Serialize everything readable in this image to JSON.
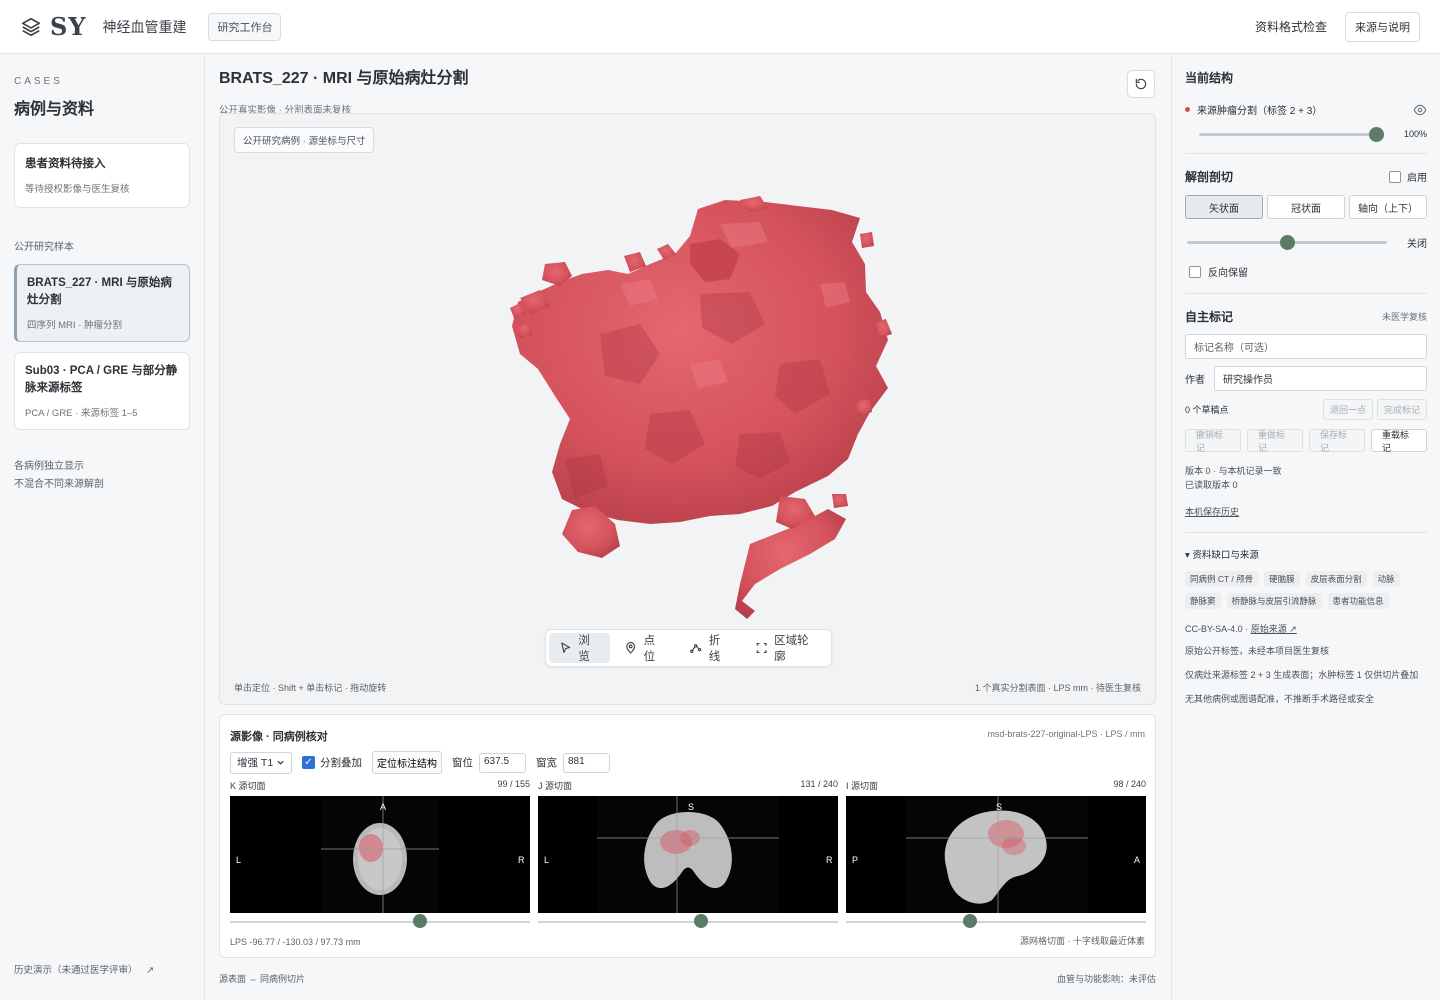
{
  "app": {
    "logo_text": "SY",
    "name": "神经血管重建",
    "workbench": "研究工作台",
    "format_check": "资料格式检查",
    "source_notes": "来源与说明"
  },
  "sidebar": {
    "kicker": "CASES",
    "title": "病例与资料",
    "pending": {
      "title": "患者资料待接入",
      "sub": "等待授权影像与医生复核"
    },
    "section": "公开研究样本",
    "cases": [
      {
        "title": "BRATS_227 · MRI 与原始病灶分割",
        "sub": "四序列 MRI · 肿瘤分割"
      },
      {
        "title": "Sub03 · PCA / GRE 与部分静脉来源标签",
        "sub": "PCA / GRE · 来源标签 1–5"
      }
    ],
    "note_1": "各病例独立显示",
    "note_2": "不混合不同来源解剖",
    "history": "历史演示（未通过医学评审）",
    "history_arrow": "↗"
  },
  "main": {
    "title": "BRATS_227 · MRI 与原始病灶分割",
    "sub": "公开真实影像 · 分割表面未复核",
    "viewer_chip": "公开研究病例 · 源坐标与尺寸",
    "tools": [
      {
        "label": "浏览",
        "icon": "cursor-icon"
      },
      {
        "label": "点位",
        "icon": "pin-icon"
      },
      {
        "label": "折线",
        "icon": "polyline-icon"
      },
      {
        "label": "区域轮廓",
        "icon": "region-icon"
      }
    ],
    "hint_left": "单击定位 · Shift + 单击标记 · 拖动旋转",
    "hint_right": "1 个真实分割表面 · LPS mm · 待医生复核",
    "foot_left": "源表面 ⇔ 同病例切片",
    "foot_right": "血管与功能影响：未评估"
  },
  "source": {
    "title": "源影像 · 同病例核对",
    "dataset_id": "msd-brats-227-original-LPS · LPS / mm",
    "sequence": "增强 T1",
    "overlay_label": "分割叠加",
    "locate_btn": "定位标注结构",
    "window_level_label": "窗位",
    "window_level_value": "637.5",
    "window_width_label": "窗宽",
    "window_width_value": "881",
    "slices": [
      {
        "name": "K 源切面",
        "index": "99 / 155",
        "top": "A",
        "left": "L",
        "right": "R",
        "fraction": 0.64
      },
      {
        "name": "J 源切面",
        "index": "131 / 240",
        "top": "S",
        "left": "L",
        "right": "R",
        "fraction": 0.545
      },
      {
        "name": "I 源切面",
        "index": "98 / 240",
        "top": "S",
        "left": "P",
        "right": "A",
        "fraction": 0.41
      }
    ],
    "coords": "LPS -96.77 / -130.03 / 97.73 mm",
    "grid_note": "源网格切面 · 十字线取最近体素"
  },
  "right": {
    "current_structure": "当前结构",
    "structure_label": "来源肿瘤分割（标签 2 + 3）",
    "opacity_value": "100%",
    "opacity_fraction": 1.0,
    "cut_title": "解剖剖切",
    "cut_enable": "启用",
    "planes": [
      "矢状面",
      "冠状面",
      "轴向（上下）"
    ],
    "cut_state": "关闭",
    "cut_fraction": 0.5,
    "reverse_keep": "反向保留",
    "marker_title": "自主标记",
    "marker_status": "未医学复核",
    "marker_name_placeholder": "标记名称（可选）",
    "author_label": "作者",
    "author_value": "研究操作员",
    "draft_points": "0 个草稿点",
    "undo_point": "退回一点",
    "finish_marker": "完成标记",
    "undo_marker": "撤销标记",
    "redo_marker": "重做标记",
    "save_marker": "保存标记",
    "reload_marker": "重载标记",
    "version_line_1": "版本 0 · 与本机记录一致",
    "version_line_2": "已读取版本 0",
    "local_history": "本机保存历史",
    "gaps_title": "▾ 资料缺口与来源",
    "gap_tags": [
      "同病例 CT / 颅骨",
      "硬脑膜",
      "皮层表面分割",
      "动脉",
      "静脉窦",
      "桥静脉与皮层引流静脉",
      "患者功能信息"
    ],
    "license": "CC-BY-SA-4.0 · ",
    "license_link": "原始来源 ↗",
    "info_1": "原始公开标签，未经本项目医生复核",
    "info_2": "仅病灶来源标签 2 + 3 生成表面；水肿标签 1 仅供切片叠加",
    "info_3": "无其他病例或图谱配准，不推断手术路径或安全"
  },
  "colors": {
    "tumor": "#d9545f",
    "accent_green": "#5d7c67",
    "checkbox_blue": "#2f6fd6"
  }
}
